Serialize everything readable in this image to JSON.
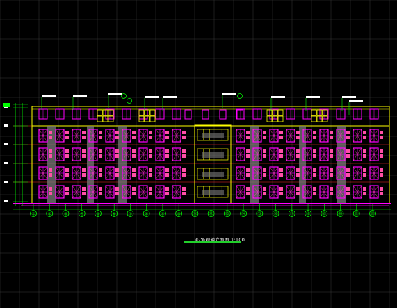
{
  "drawing": {
    "caption": "④-≫观轴立面图  1:100",
    "axis_labels": [
      "①",
      "②",
      "③",
      "④",
      "⑤",
      "⑥",
      "⑦",
      "⑧",
      "⑨",
      "⑩",
      "⑪",
      "⑫",
      "⑬",
      "⑭",
      "⑮",
      "⑯",
      "⑰",
      "⑱",
      "⑲",
      "⑳",
      "㉑",
      "㉒"
    ],
    "colors": {
      "background": "#000000",
      "grid": "#3a3a3a",
      "outline": "#ffff00",
      "window": "#ff00ff",
      "window_fill": "#ff4fa8",
      "column": "#7a7a7a",
      "ground": "#ff00ff",
      "axis": "#00ff00",
      "floor_line": "#ff2a2a",
      "dimension": "#00ff00",
      "caption_line": "#22d02b"
    }
  }
}
